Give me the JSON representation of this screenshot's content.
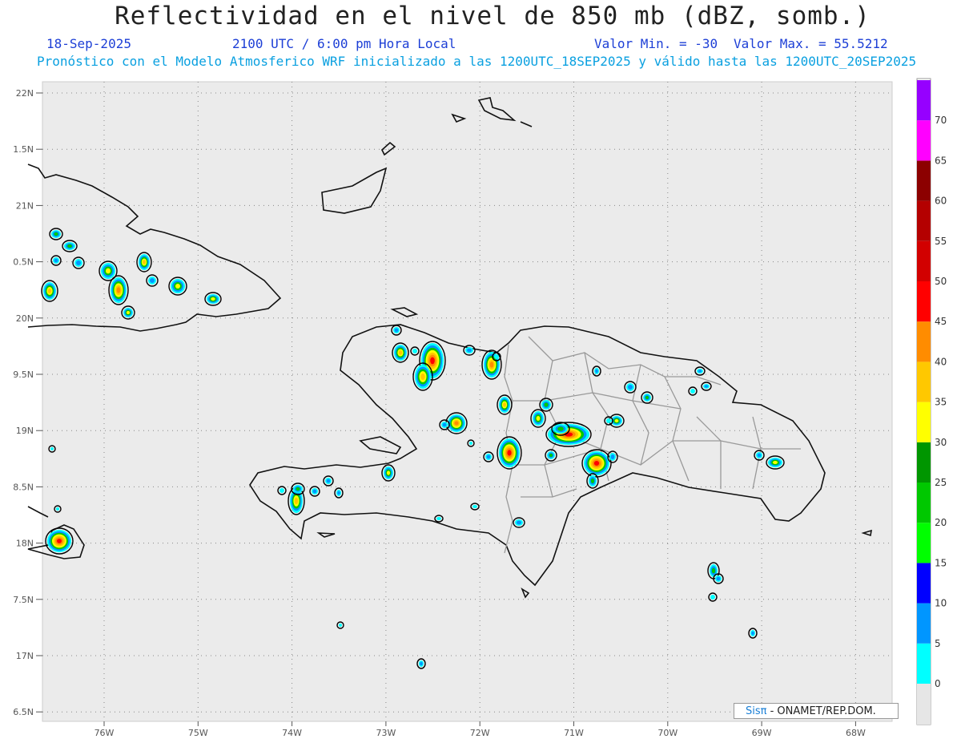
{
  "header": {
    "title": "Reflectividad en el nivel de 850 mb (dBZ, somb.)",
    "date": "18-Sep-2025",
    "time": "2100 UTC / 6:00 pm Hora Local",
    "min_label": "Valor Min. = -30",
    "max_label": "Valor Max. = 55.5212",
    "forecast_note": "Pronóstico con el Modelo Atmosferico WRF inicializado a las 1200UTC_18SEP2025 y válido hasta las  1200UTC_20SEP2025"
  },
  "axes": {
    "lat_labels": [
      "22N",
      "1.5N",
      "21N",
      "0.5N",
      "20N",
      "9.5N",
      "19N",
      "8.5N",
      "18N",
      "7.5N",
      "17N",
      "6.5N"
    ],
    "lon_labels": [
      "76W",
      "75W",
      "74W",
      "73W",
      "72W",
      "71W",
      "70W",
      "69W",
      "68W"
    ]
  },
  "colorbar": {
    "levels": [
      "0",
      "5",
      "10",
      "15",
      "20",
      "25",
      "30",
      "35",
      "40",
      "45",
      "50",
      "55",
      "60",
      "65",
      "70"
    ],
    "colors": [
      "#00ffff",
      "#0096ff",
      "#0000ff",
      "#00ff00",
      "#00c800",
      "#009600",
      "#ffff00",
      "#ffc800",
      "#ff8c00",
      "#ff0000",
      "#d20000",
      "#b40000",
      "#8c0000",
      "#ff00ff",
      "#9600ff"
    ]
  },
  "credit": {
    "brand": "Sisπ",
    "text": " - ONAMET/REP.DOM."
  }
}
